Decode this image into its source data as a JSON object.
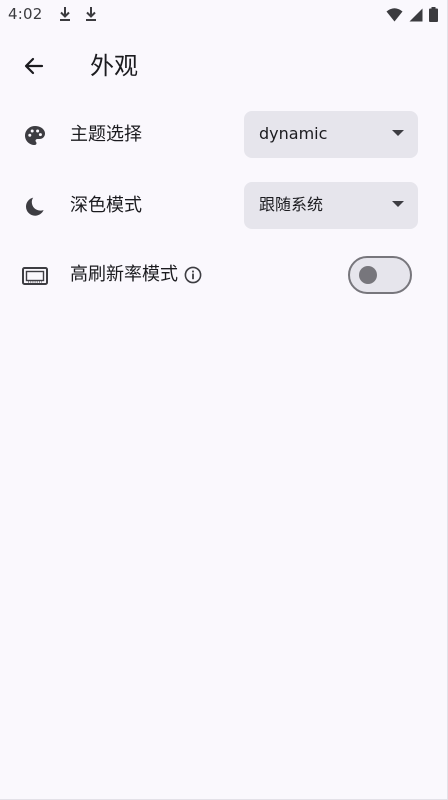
{
  "status_bar": {
    "time": "4:02"
  },
  "app_bar": {
    "title": "外观"
  },
  "settings": {
    "theme": {
      "label": "主题选择",
      "value": "dynamic"
    },
    "dark_mode": {
      "label": "深色模式",
      "value": "跟随系统"
    },
    "high_refresh": {
      "label": "高刷新率模式",
      "enabled": false
    }
  },
  "colors": {
    "background": "#faf8fd",
    "dropdown_bg": "#e6e5ec",
    "icon": "#3d3d42",
    "switch_outline": "#77767c"
  },
  "icons": {
    "back": "arrow-back-icon",
    "theme": "palette-icon",
    "dark_mode": "moon-icon",
    "high_refresh": "screen-frame-icon",
    "info": "info-icon"
  }
}
